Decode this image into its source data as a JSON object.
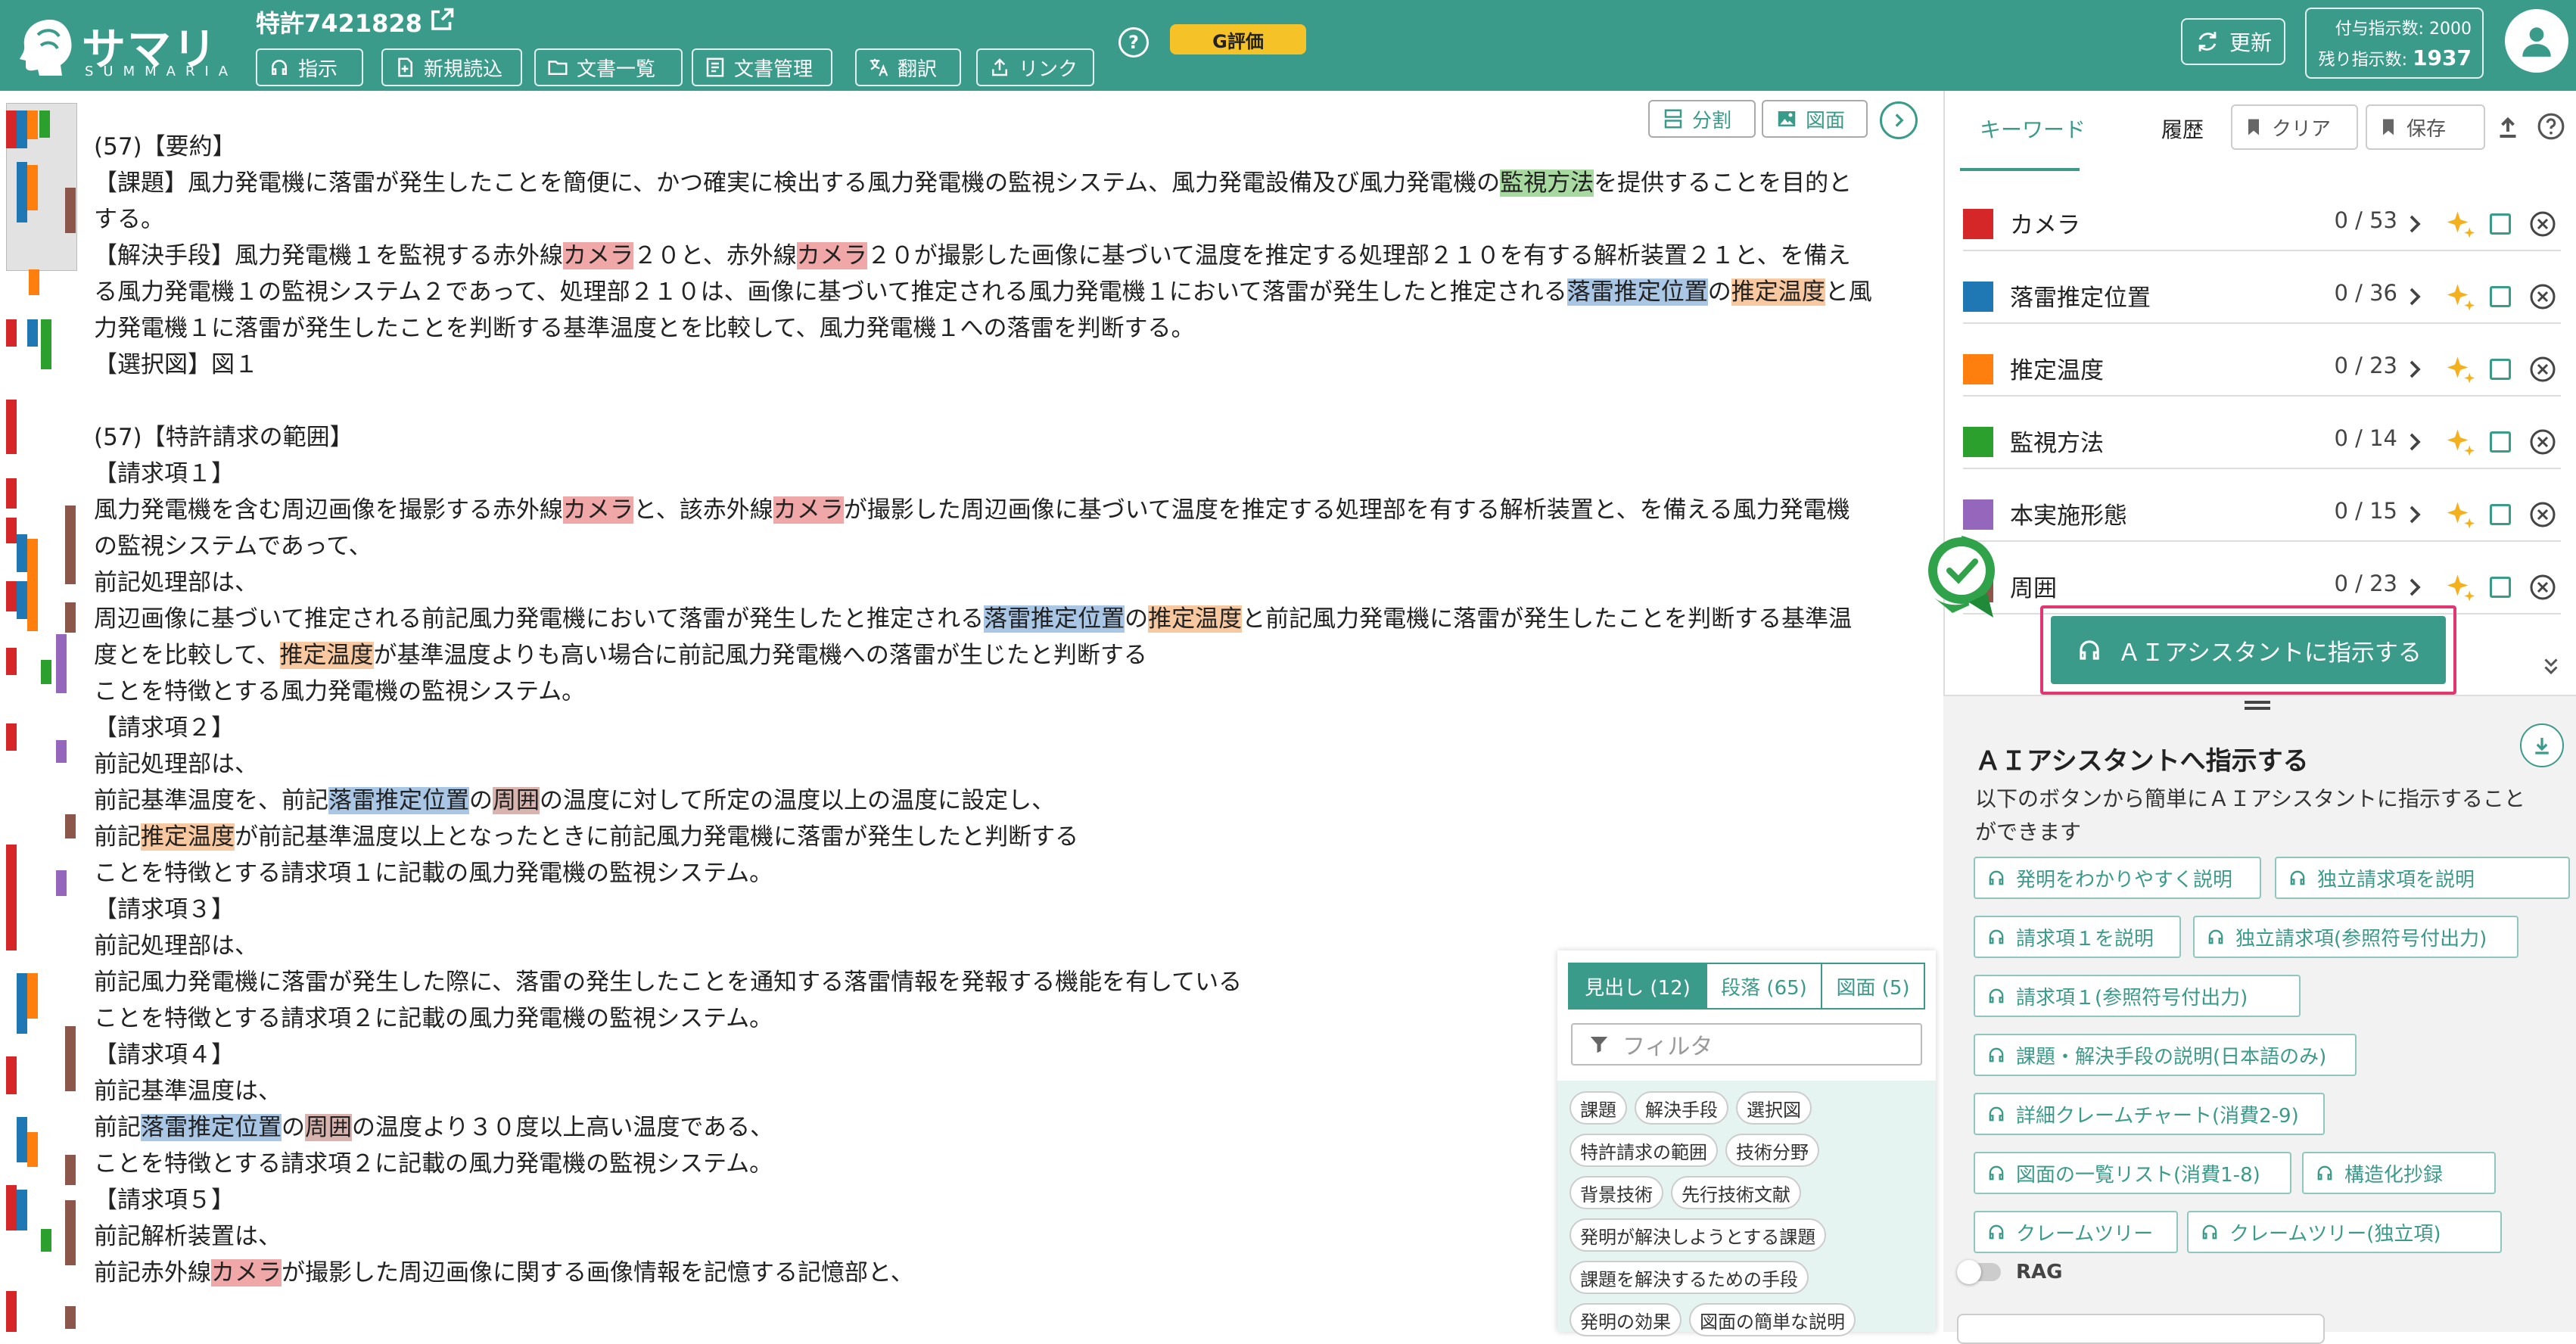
{
  "header": {
    "logo_main": "サマリア",
    "logo_sub": "SUMMARIA",
    "patent_title": "特許7421828",
    "buttons": [
      "指示",
      "新規読込",
      "文書一覧",
      "文書管理",
      "翻訳",
      "リンク"
    ],
    "help": "?",
    "badge": "G評価",
    "refresh": "更新",
    "granted_label": "付与指示数:",
    "granted_value": "2000",
    "remaining_label": "残り指示数:",
    "remaining_value": "1937"
  },
  "doc_tools": {
    "split": "分割",
    "figure": "図面"
  },
  "document": {
    "lines": [
      [
        [
          "(57)【要約】",
          ""
        ]
      ],
      [
        [
          "【課題】風力発電機に落雷が発生したことを簡便に、かつ確実に検出する風力発電機の監視システム、風力発電設備及び風力発電機の",
          ""
        ],
        [
          "監視方法",
          "g"
        ],
        [
          "を提供することを目的と",
          ""
        ]
      ],
      [
        [
          "する。",
          ""
        ]
      ],
      [
        [
          "【解決手段】風力発電機１を監視する赤外線",
          ""
        ],
        [
          "カメラ",
          "r"
        ],
        [
          "２０と、赤外線",
          ""
        ],
        [
          "カメラ",
          "r"
        ],
        [
          "２０が撮影した画像に基づいて温度を推定する処理部２１０を有する解析装置２１と、を備え",
          ""
        ]
      ],
      [
        [
          "る風力発電機１の監視システム２であって、処理部２１０は、画像に基づいて推定される風力発電機１において落雷が発生したと推定される",
          ""
        ],
        [
          "落雷推定位置",
          "b"
        ],
        [
          "の",
          ""
        ],
        [
          "推定温度",
          "o"
        ],
        [
          "と風",
          ""
        ]
      ],
      [
        [
          "力発電機１に落雷が発生したことを判断する基準温度とを比較して、風力発電機１への落雷を判断する。",
          ""
        ]
      ],
      [
        [
          "【選択図】図１",
          ""
        ]
      ],
      [
        [
          "",
          ""
        ]
      ],
      [
        [
          "(57)【特許請求の範囲】",
          ""
        ]
      ],
      [
        [
          "【請求項１】",
          ""
        ]
      ],
      [
        [
          "風力発電機を含む周辺画像を撮影する赤外線",
          ""
        ],
        [
          "カメラ",
          "r"
        ],
        [
          "と、該赤外線",
          ""
        ],
        [
          "カメラ",
          "r"
        ],
        [
          "が撮影した周辺画像に基づいて温度を推定する処理部を有する解析装置と、を備える風力発電機",
          ""
        ]
      ],
      [
        [
          "の監視システムであって、",
          ""
        ]
      ],
      [
        [
          "前記処理部は、",
          ""
        ]
      ],
      [
        [
          "周辺画像に基づいて推定される前記風力発電機において落雷が発生したと推定される",
          ""
        ],
        [
          "落雷推定位置",
          "b"
        ],
        [
          "の",
          ""
        ],
        [
          "推定温度",
          "o"
        ],
        [
          "と前記風力発電機に落雷が発生したことを判断する基準温",
          ""
        ]
      ],
      [
        [
          "度とを比較して、",
          ""
        ],
        [
          "推定温度",
          "o"
        ],
        [
          "が基準温度よりも高い場合に前記風力発電機への落雷が生じたと判断する",
          ""
        ]
      ],
      [
        [
          "ことを特徴とする風力発電機の監視システム。",
          ""
        ]
      ],
      [
        [
          "【請求項２】",
          ""
        ]
      ],
      [
        [
          "前記処理部は、",
          ""
        ]
      ],
      [
        [
          "前記基準温度を、前記",
          ""
        ],
        [
          "落雷推定位置",
          "b"
        ],
        [
          "の",
          ""
        ],
        [
          "周囲",
          "br"
        ],
        [
          "の温度に対して所定の温度以上の温度に設定し、",
          ""
        ]
      ],
      [
        [
          "前記",
          ""
        ],
        [
          "推定温度",
          "o"
        ],
        [
          "が前記基準温度以上となったときに前記風力発電機に落雷が発生したと判断する",
          ""
        ]
      ],
      [
        [
          "ことを特徴とする請求項１に記載の風力発電機の監視システム。",
          ""
        ]
      ],
      [
        [
          "【請求項３】",
          ""
        ]
      ],
      [
        [
          "前記処理部は、",
          ""
        ]
      ],
      [
        [
          "前記風力発電機に落雷が発生した際に、落雷の発生したことを通知する落雷情報を発報する機能を有している",
          ""
        ]
      ],
      [
        [
          "ことを特徴とする請求項２に記載の風力発電機の監視システム。",
          ""
        ]
      ],
      [
        [
          "【請求項４】",
          ""
        ]
      ],
      [
        [
          "前記基準温度は、",
          ""
        ]
      ],
      [
        [
          "前記",
          ""
        ],
        [
          "落雷推定位置",
          "b"
        ],
        [
          "の",
          ""
        ],
        [
          "周囲",
          "br"
        ],
        [
          "の温度より３０度以上高い温度である、",
          ""
        ]
      ],
      [
        [
          "ことを特徴とする請求項２に記載の風力発電機の監視システム。",
          ""
        ]
      ],
      [
        [
          "【請求項５】",
          ""
        ]
      ],
      [
        [
          "前記解析装置は、",
          ""
        ]
      ],
      [
        [
          "前記赤外線",
          ""
        ],
        [
          "カメラ",
          "r"
        ],
        [
          "が撮影した周辺画像に関する画像情報を記憶する記憶部と、",
          ""
        ]
      ]
    ]
  },
  "outline": {
    "tabs": [
      "見出し (12)",
      "段落 (65)",
      "図面 (5)"
    ],
    "filter_placeholder": "フィルタ",
    "chip_rows": [
      [
        "課題",
        "解決手段",
        "選択図"
      ],
      [
        "特許請求の範囲",
        "技術分野"
      ],
      [
        "背景技術",
        "先行技術文献"
      ],
      [
        "発明が解決しようとする課題"
      ],
      [
        "課題を解決するための手段"
      ],
      [
        "発明の効果",
        "図面の簡単な説明"
      ]
    ]
  },
  "right_panel": {
    "tab_keyword": "キーワード",
    "tab_history": "履歴",
    "clear": "クリア",
    "save": "保存",
    "keywords": [
      {
        "name": "カメラ",
        "count": "0 / 53",
        "color": "#d62728"
      },
      {
        "name": "落雷推定位置",
        "count": "0 / 36",
        "color": "#1f77b4"
      },
      {
        "name": "推定温度",
        "count": "0 / 23",
        "color": "#ff7f0e"
      },
      {
        "name": "監視方法",
        "count": "0 / 14",
        "color": "#2ca02c"
      },
      {
        "name": "本実施形態",
        "count": "0 / 15",
        "color": "#9467bd"
      },
      {
        "name": "周囲",
        "count": "0 / 23",
        "color": "#8c564b"
      }
    ],
    "ai_main_button": "ＡＩアシスタントに指示する",
    "section_title": "ＡＩアシスタントへ指示する",
    "section_desc": "以下のボタンから簡単にＡＩアシスタントに指示することができます",
    "ai_buttons": [
      "発明をわかりやすく説明",
      "独立請求項を説明",
      "請求項１を説明",
      "独立請求項(参照符号付出力)",
      "請求項１(参照符号付出力)",
      "課題・解決手段の説明(日本語のみ)",
      "詳細クレームチャート(消費2-9)",
      "図面の一覧リスト(消費1-8)",
      "構造化抄録",
      "クレームツリー",
      "クレームツリー(独立項)"
    ],
    "rag_label": "RAG"
  },
  "colors": {
    "accent": "#3b9b8b",
    "badge": "#f5c227",
    "highlight_border": "#e2366e"
  }
}
